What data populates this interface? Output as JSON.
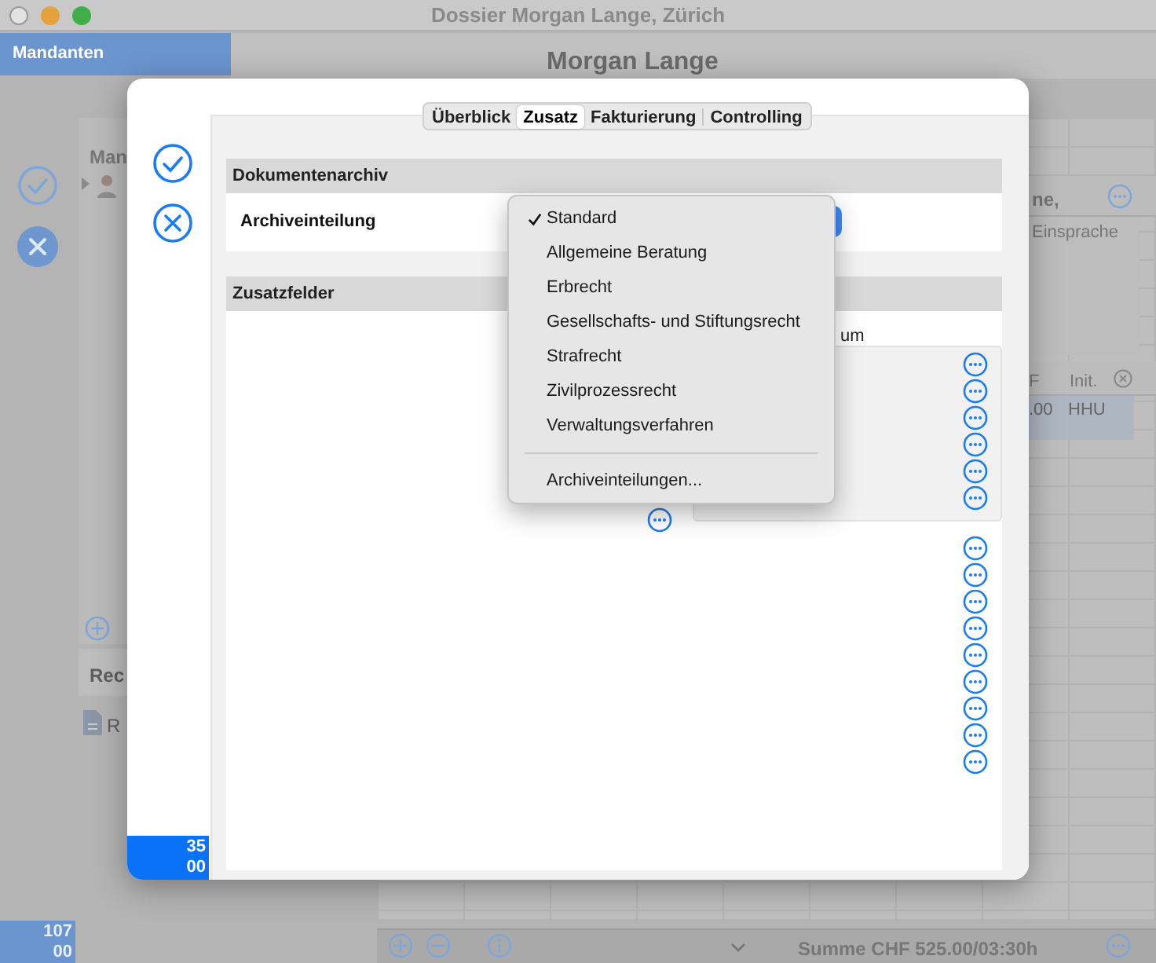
{
  "window": {
    "title": "Dossier Morgan Lange, Zürich"
  },
  "sidebar": {
    "header": "Mandanten",
    "panel_1_title": "Man",
    "panel_2_title": "Rec",
    "panel_2_item": "R",
    "counter": [
      "107",
      "00"
    ]
  },
  "header": {
    "title": "Morgan Lange"
  },
  "background_table": {
    "column_1_fragment": "ne,",
    "cell_1": "Einsprache",
    "columns": [
      "F",
      "Init."
    ],
    "row": [
      ".00",
      "HHU"
    ]
  },
  "status_bar": {
    "summary": "Summe CHF 525.00/03:30h"
  },
  "sheet": {
    "tabs": [
      {
        "label": "Überblick",
        "selected": false
      },
      {
        "label": "Zusatz",
        "selected": true
      },
      {
        "label": "Fakturierung",
        "selected": false
      },
      {
        "label": "Controlling",
        "selected": false
      }
    ],
    "counter": [
      "35",
      "00"
    ],
    "sections": [
      {
        "title": "Dokumentenarchiv",
        "field_label": "Archiveinteilung"
      },
      {
        "title": "Zusatzfelder",
        "fragment": "um"
      }
    ],
    "menu": [
      {
        "kind": "item",
        "label": "Standard",
        "selected": true
      },
      {
        "kind": "item",
        "label": "Allgemeine Beratung",
        "selected": false
      },
      {
        "kind": "item",
        "label": "Erbrecht",
        "selected": false
      },
      {
        "kind": "item",
        "label": "Gesellschafts- und Stiftungsrecht",
        "selected": false
      },
      {
        "kind": "item",
        "label": "Strafrecht",
        "selected": false
      },
      {
        "kind": "item",
        "label": "Zivilprozessrecht",
        "selected": false
      },
      {
        "kind": "item",
        "label": "Verwaltungsverfahren",
        "selected": false
      },
      {
        "kind": "separator"
      },
      {
        "kind": "item",
        "label": "Archiveinteilungen...",
        "selected": false
      }
    ]
  }
}
